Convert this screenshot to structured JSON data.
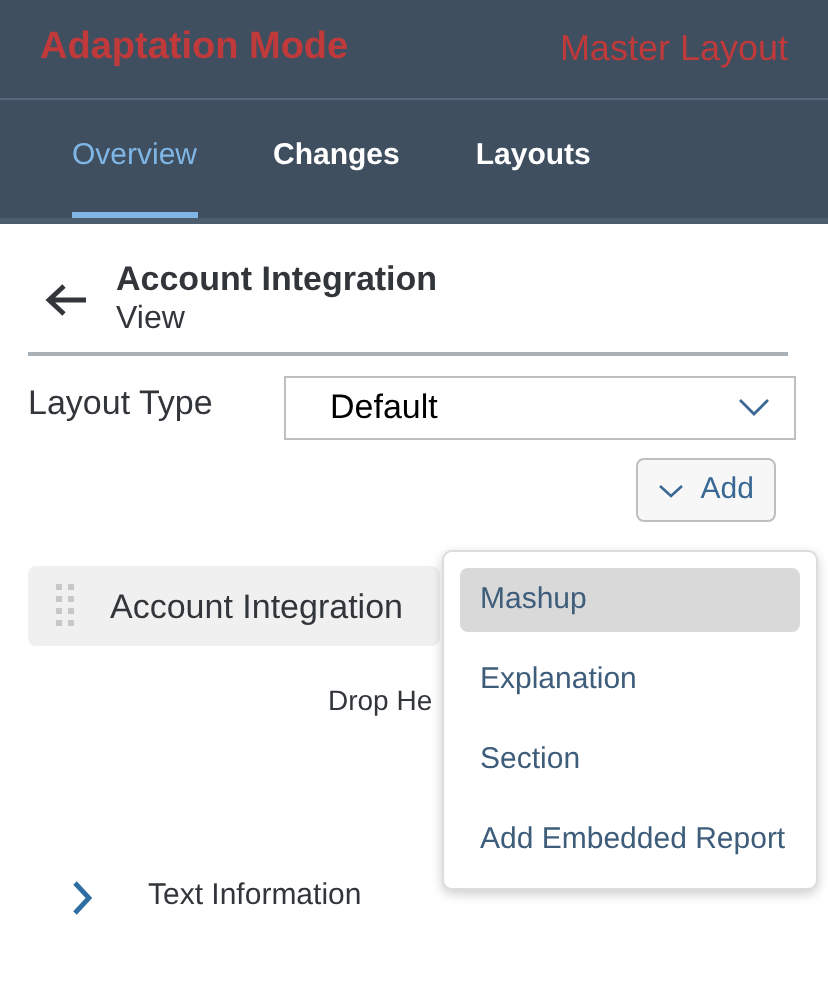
{
  "header": {
    "title": "Adaptation Mode",
    "layout": "Master Layout"
  },
  "tabs": [
    {
      "label": "Overview",
      "selected": true
    },
    {
      "label": "Changes",
      "selected": false
    },
    {
      "label": "Layouts",
      "selected": false
    }
  ],
  "page": {
    "title": "Account Integration",
    "subtitle": "View"
  },
  "layout_type": {
    "label": "Layout Type",
    "value": "Default"
  },
  "add_button": {
    "label": "Add"
  },
  "add_menu": [
    {
      "label": "Mashup",
      "selected": true
    },
    {
      "label": "Explanation",
      "selected": false
    },
    {
      "label": "Section",
      "selected": false
    },
    {
      "label": "Add Embedded Report",
      "selected": false
    }
  ],
  "section_bar": {
    "title": "Account Integration"
  },
  "drop_hint": "Drop He",
  "groups": [
    {
      "label": "Text Information",
      "expanded": false
    }
  ]
}
